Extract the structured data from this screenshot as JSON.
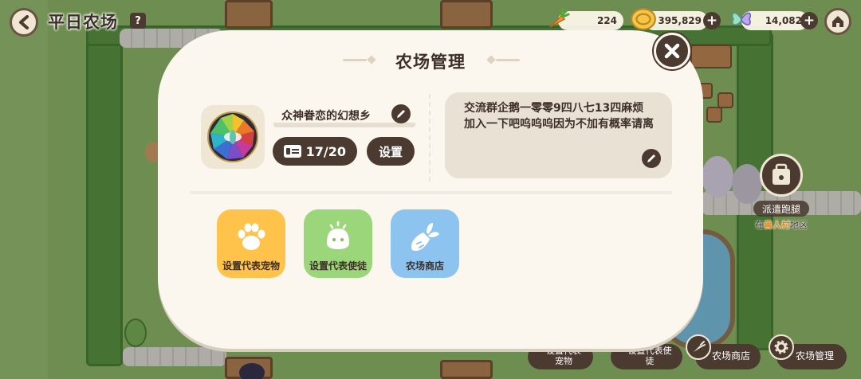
{
  "hud": {
    "farm_title": "平日农场",
    "help_label": "?",
    "carrots": "224",
    "coins": "395,829",
    "gems": "14,082"
  },
  "side": {
    "dispatch_label": "派遣跑腿",
    "location_prefix": "在",
    "location_name": "兽人村",
    "location_suffix": "地区"
  },
  "bottom_bar": {
    "pet_label": "设置代表宠物",
    "envoy_label": "设置代表使徒",
    "shop_label": "农场商店",
    "manage_label": "农场管理"
  },
  "modal": {
    "title": "农场管理",
    "farm_name": "众神眷恋的幻想乡",
    "member_count": "17/20",
    "settings_label": "设置",
    "description": "交流群企鹅一零零9四八七13四麻烦加入一下吧呜呜呜因为不加有概率请离",
    "actions": [
      {
        "label": "设置代表宠物",
        "color": "#ffc24b"
      },
      {
        "label": "设置代表使徒",
        "color": "#9bd67a"
      },
      {
        "label": "农场商店",
        "color": "#8cc3ef"
      }
    ]
  }
}
